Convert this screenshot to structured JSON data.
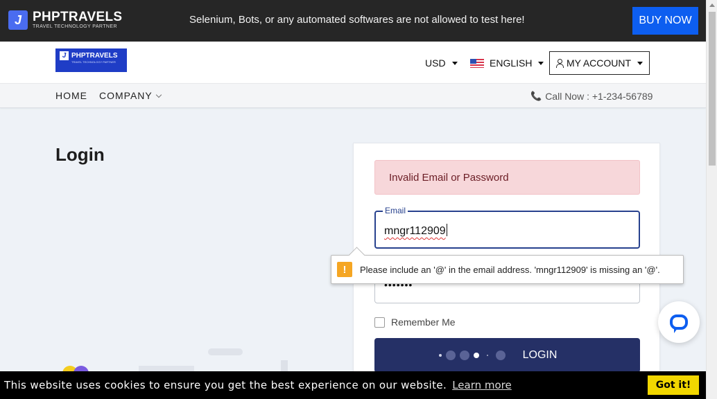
{
  "topbar": {
    "brand_name": "PHPTRAVELS",
    "brand_tagline": "TRAVEL TECHNOLOGY PARTNER",
    "notice": "Selenium, Bots, or any automated softwares are not allowed to test here!",
    "buy_label": "BUY NOW",
    "buy_color": "#0d5ef0"
  },
  "header": {
    "logo_name": "PHPTRAVELS",
    "logo_tagline": "TRAVEL TECHNOLOGY PARTNER",
    "currency": "USD",
    "language": "ENGLISH",
    "account": "MY ACCOUNT"
  },
  "nav": {
    "home": "HOME",
    "company": "COMPANY",
    "call": "Call Now : +1-234-56789"
  },
  "page": {
    "title": "Login"
  },
  "login_form": {
    "error_message": "Invalid Email or Password",
    "email_label": "Email",
    "email_value": "mngr112909",
    "password_masked": "•••••••",
    "remember_label": "Remember Me",
    "submit_label": "LOGIN"
  },
  "validation_tooltip": {
    "message": "Please include an '@' in the email address. 'mngr112909' is missing an '@'.",
    "icon": "warning-icon"
  },
  "cookie_bar": {
    "message": "This website uses cookies to ensure you get the best experience on our website.",
    "learn_more": "Learn more",
    "accept": "Got it!",
    "accept_color": "#f1d600"
  },
  "colors": {
    "topbar_bg": "#262626",
    "primary_button": "#253066",
    "alert_bg": "#f7d7da"
  }
}
